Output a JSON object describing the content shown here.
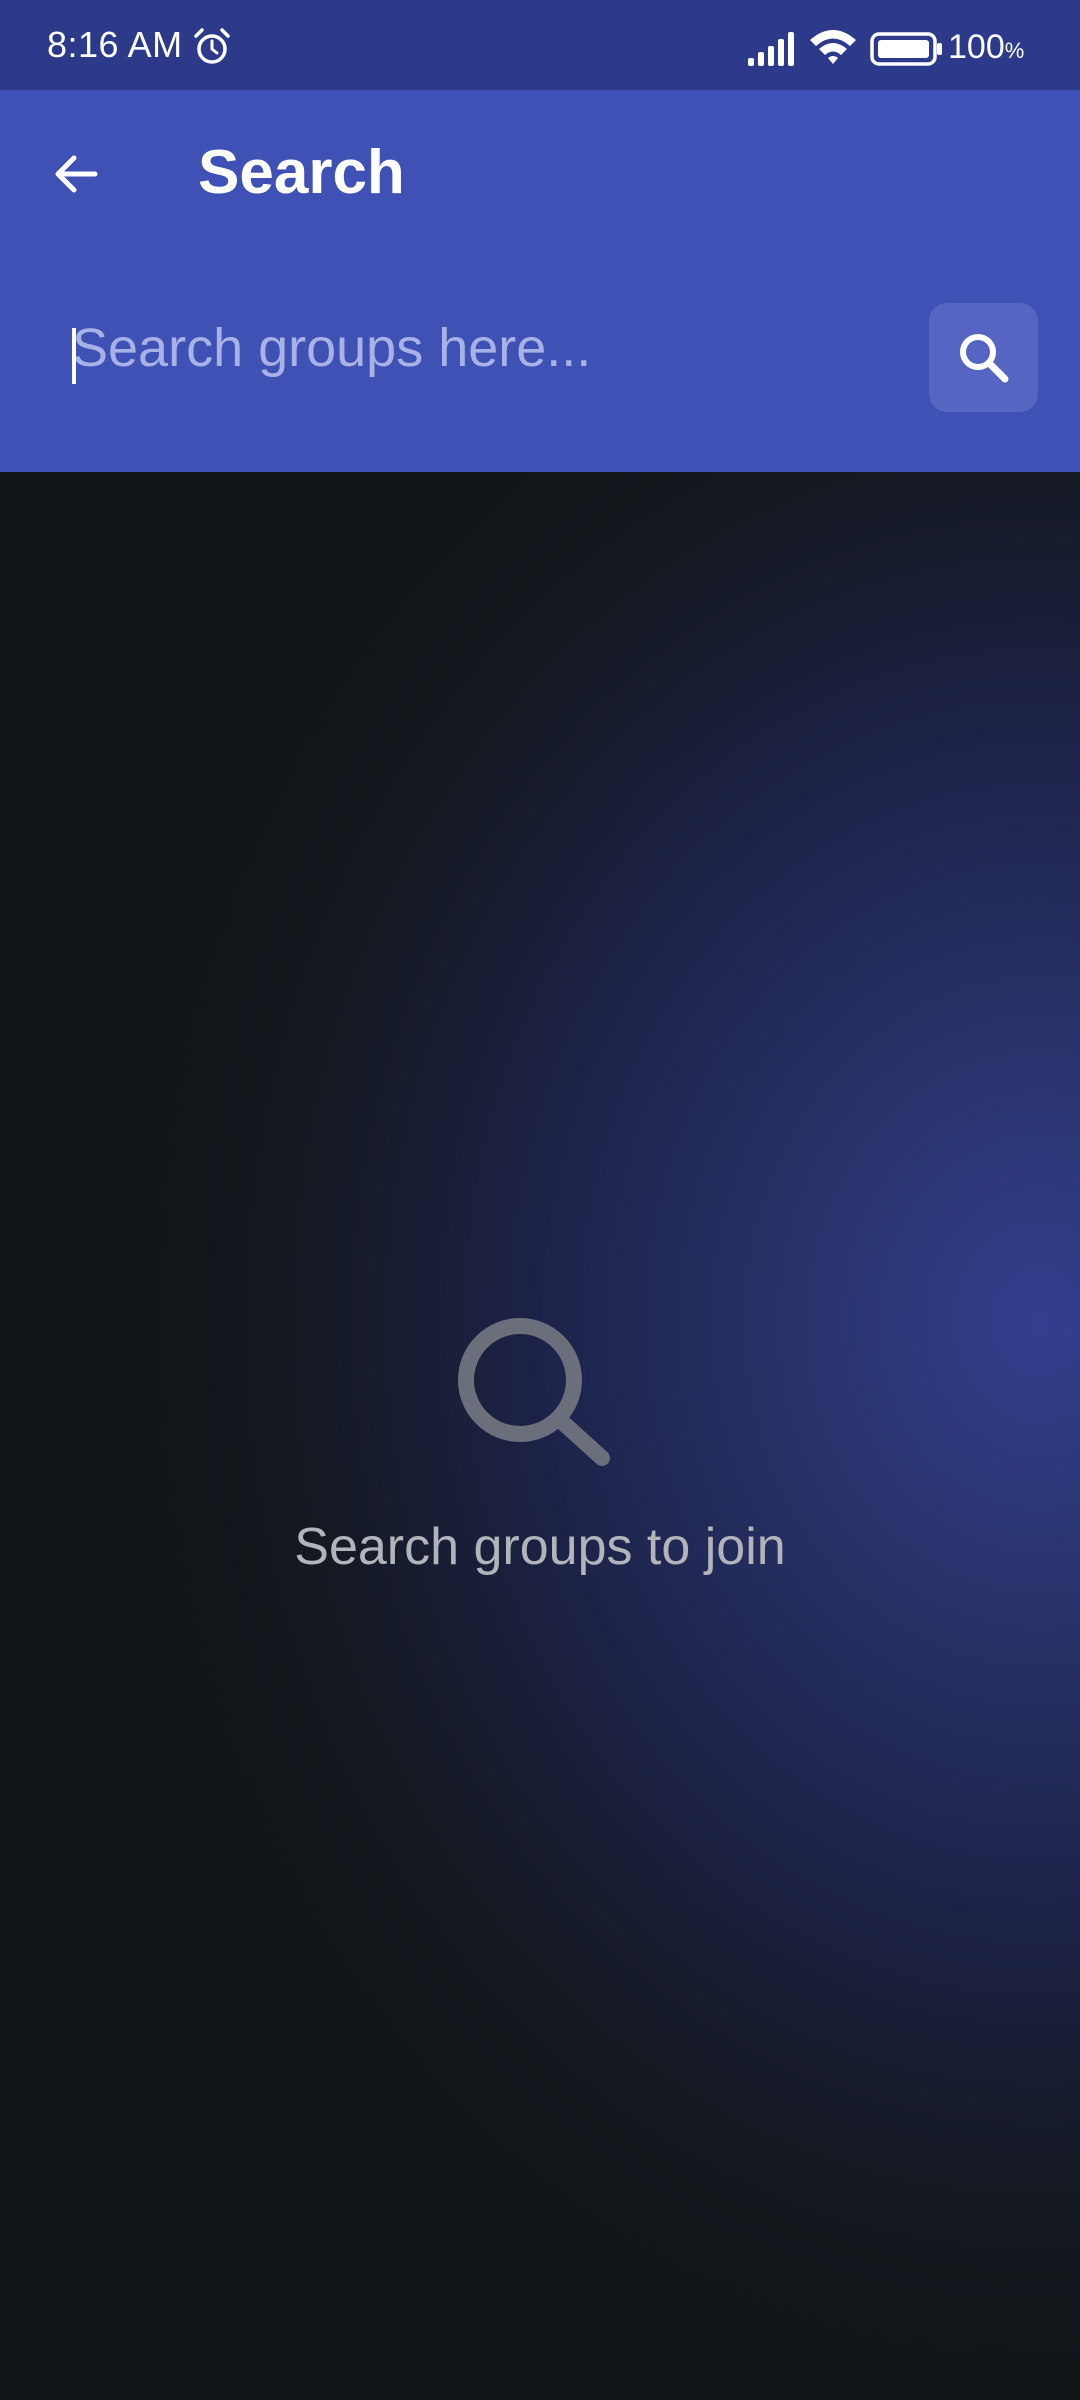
{
  "status_bar": {
    "time": "8:16 AM",
    "battery_level": "100",
    "battery_unit": "%",
    "icons": [
      "alarm-icon",
      "signal-icon",
      "wifi-icon",
      "battery-icon"
    ]
  },
  "header": {
    "title": "Search",
    "back_icon": "arrow-left-icon",
    "background_color": "#3f51b5"
  },
  "search": {
    "placeholder": "Search groups here...",
    "value": "",
    "button_icon": "search-icon"
  },
  "empty_state": {
    "icon": "search-icon",
    "message": "Search groups to join"
  },
  "colors": {
    "status_bar": "#2d3a8a",
    "header": "#3f51b5",
    "search_button": "#5565c1",
    "background_dark": "#111518",
    "background_glow": "#333f8e"
  }
}
